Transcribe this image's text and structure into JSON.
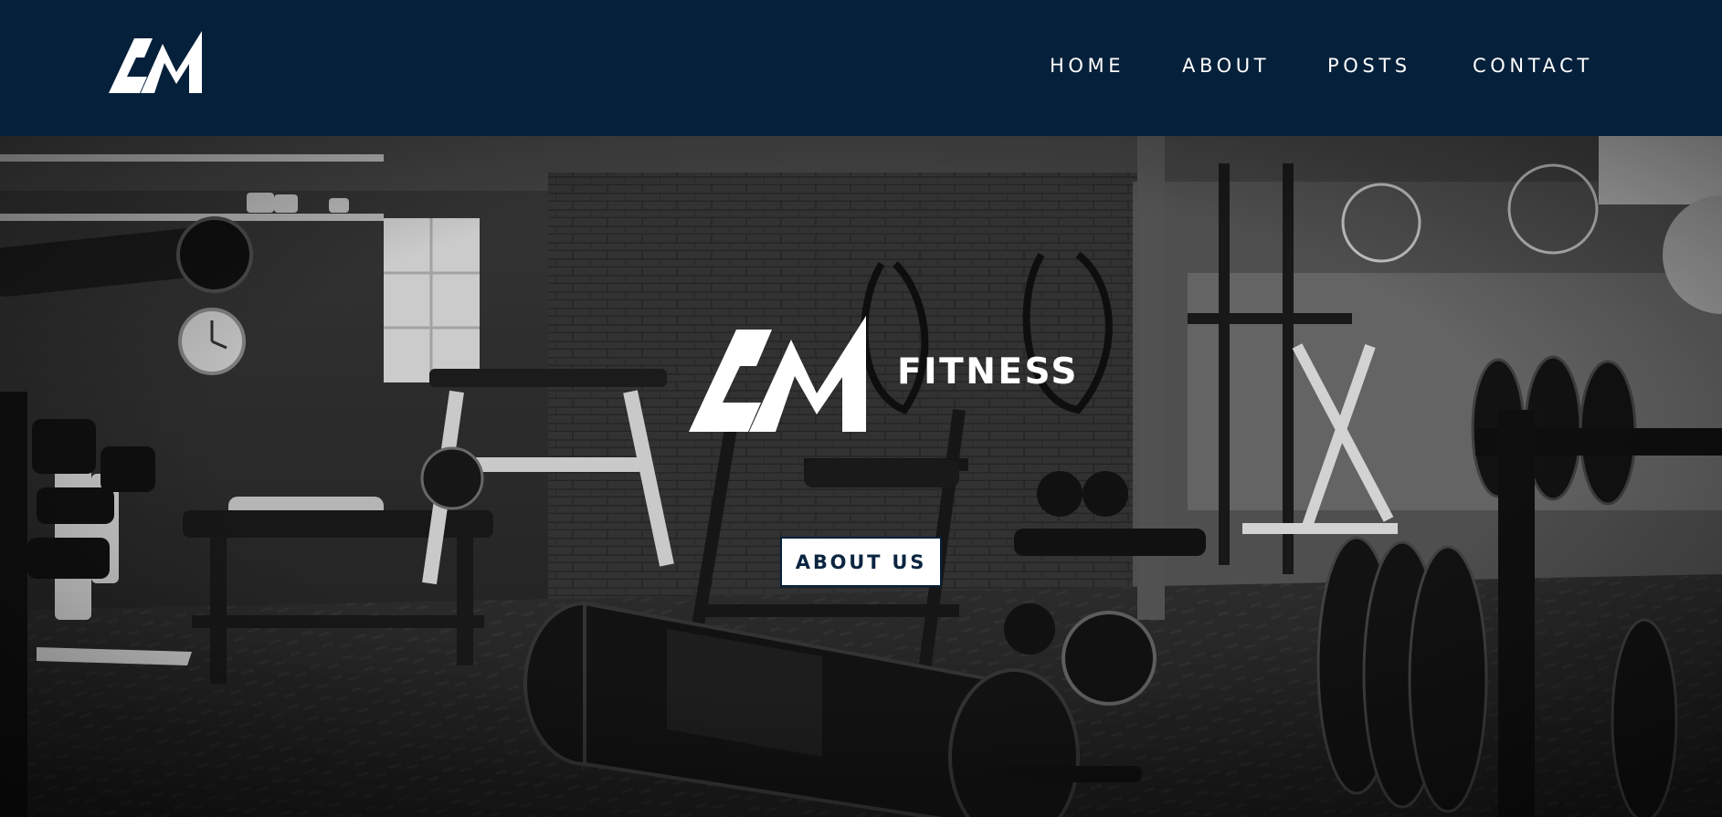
{
  "brand": {
    "logo_text": "AM"
  },
  "nav": {
    "items": [
      {
        "label": "HOME"
      },
      {
        "label": "ABOUT"
      },
      {
        "label": "POSTS"
      },
      {
        "label": "CONTACT"
      }
    ]
  },
  "hero": {
    "title": "FITNESS",
    "button_label": "ABOUT US",
    "image_alt": "Gym interior with weights and equipment in black and white"
  },
  "colors": {
    "header_bg": "#05203a",
    "text": "#ffffff",
    "button_bg": "#ffffff",
    "button_text": "#0b2540"
  }
}
